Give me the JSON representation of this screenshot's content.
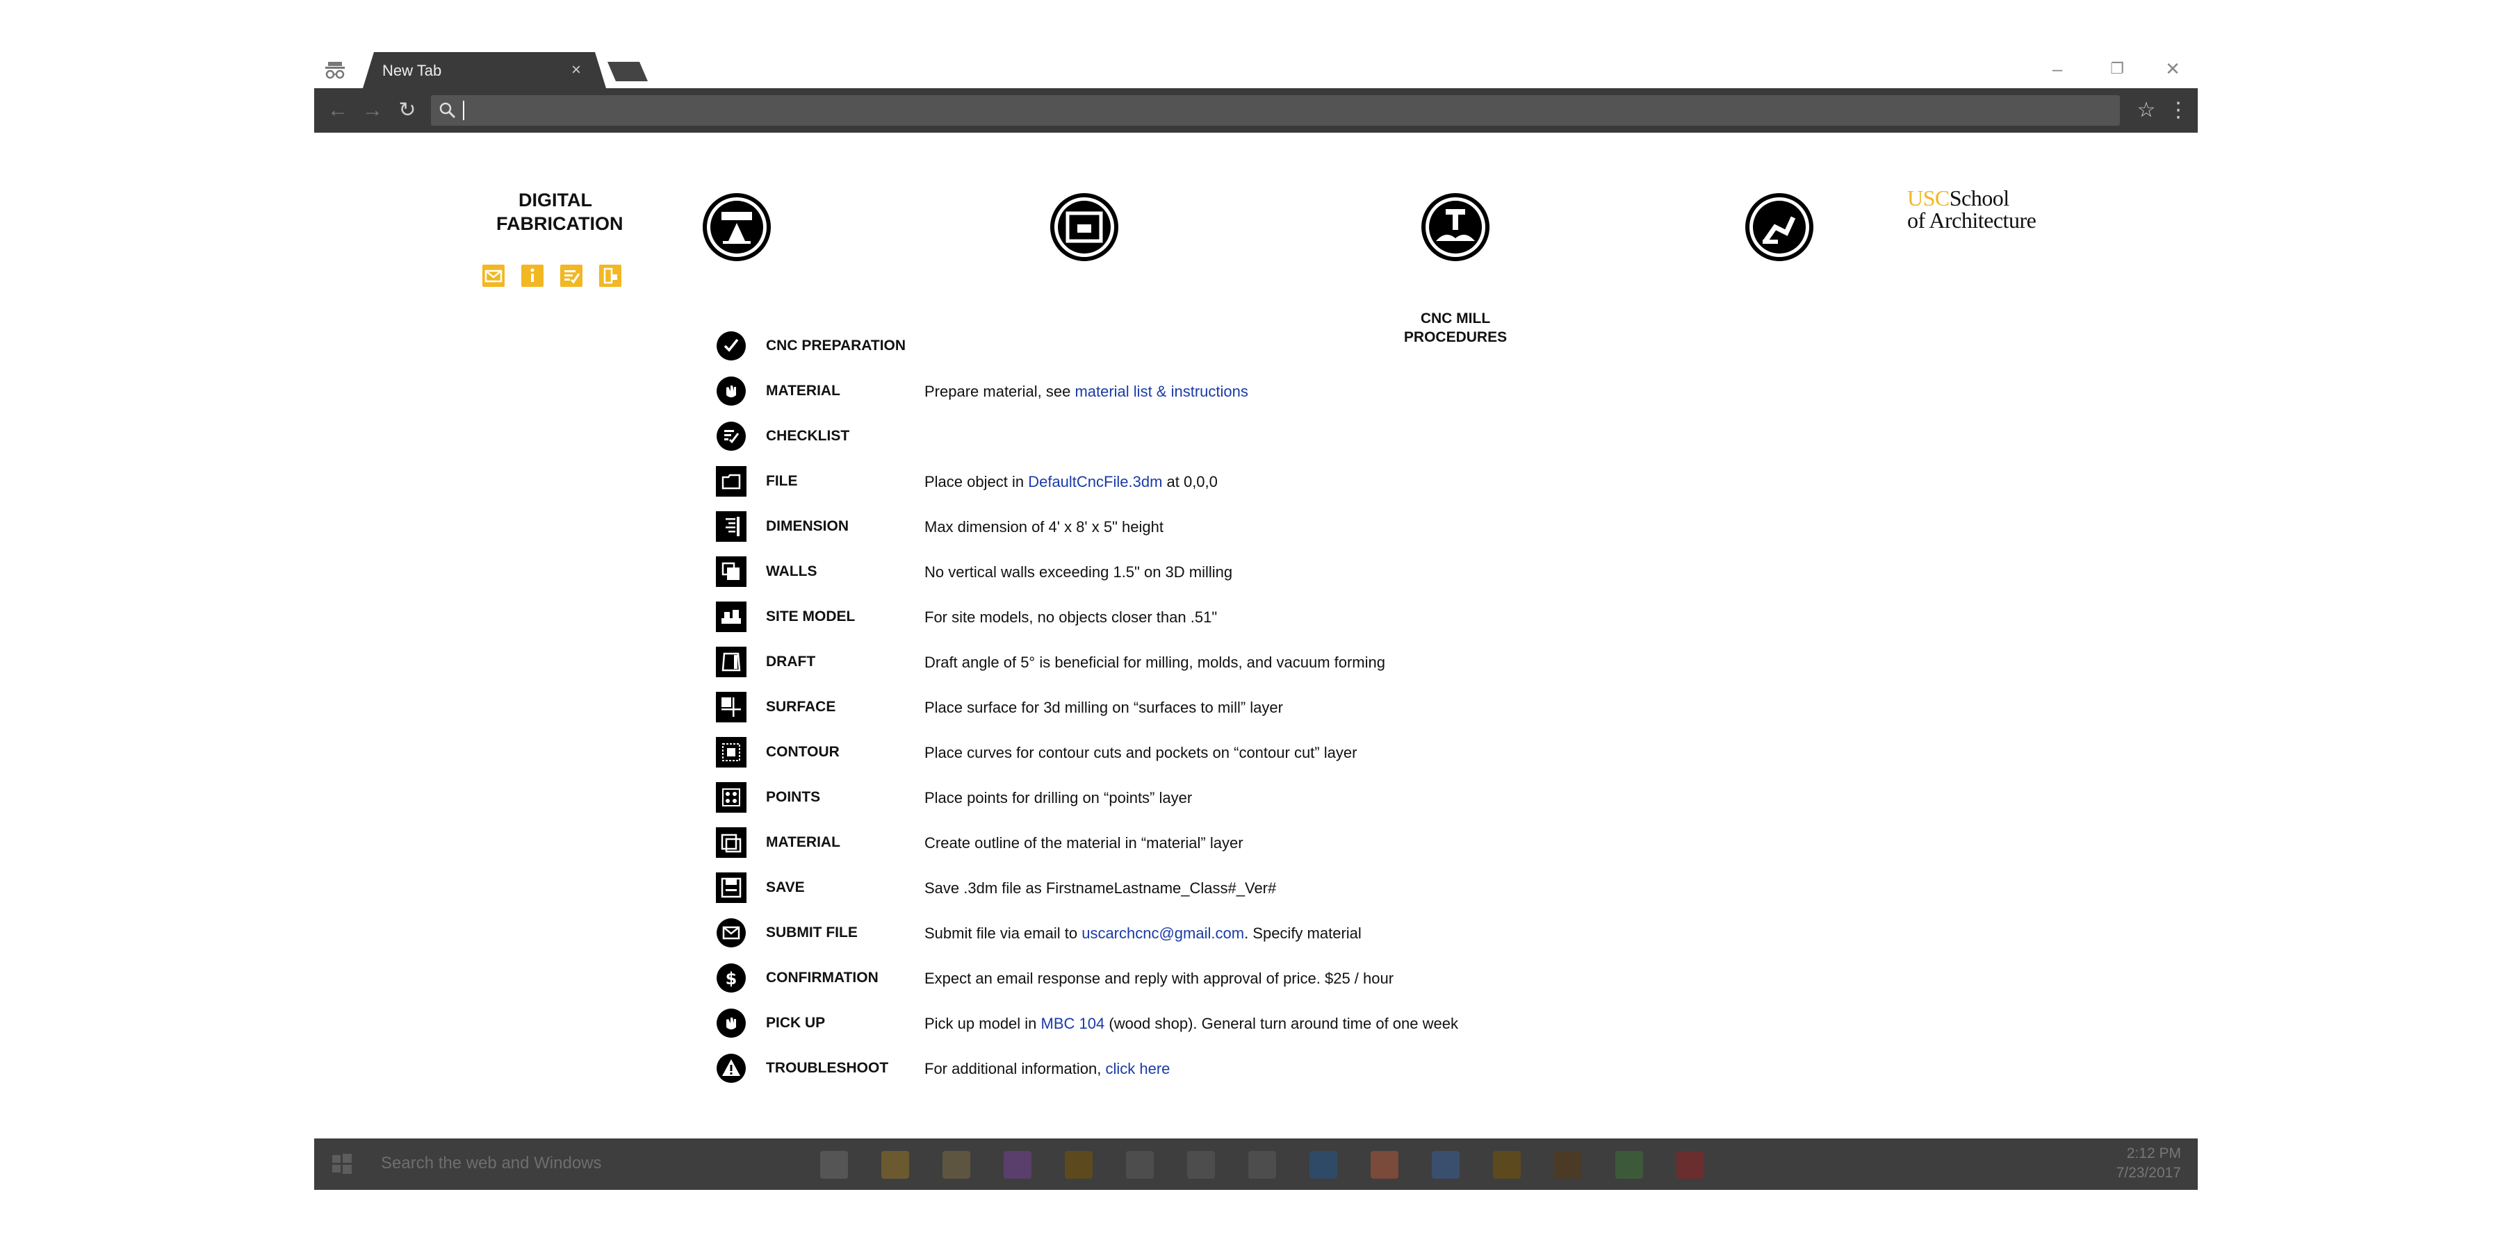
{
  "browser": {
    "tab_title": "New Tab",
    "tab_close": "×",
    "address_value": "",
    "window_controls": {
      "minimize": "–",
      "restore": "❐",
      "close": "✕"
    },
    "buttons": {
      "back": "←",
      "forward": "→",
      "reload": "↻",
      "bookmark": "☆",
      "menu": "⋮"
    }
  },
  "page": {
    "brand_line1": "DIGITAL",
    "brand_line2": "FABRICATION",
    "brand_icons": [
      "mail-icon",
      "info-icon",
      "checklist-icon",
      "pickup-icon"
    ],
    "accent_color": "#f2b722",
    "hub_label_line1": "CNC MILL",
    "hub_label_line2": "PROCEDURES",
    "usc_acronym": "USC",
    "usc_line1": "School",
    "usc_line2": "of Architecture",
    "steps": [
      {
        "icon": "checkmark-icon",
        "label": "CNC PREPARATION",
        "desc": "",
        "link": "",
        "after": ""
      },
      {
        "icon": "hand-icon",
        "label": "MATERIAL",
        "desc": "Prepare material, see ",
        "link": "material list & instructions",
        "after": ""
      },
      {
        "icon": "checklist-icon",
        "label": "CHECKLIST",
        "desc": "",
        "link": "",
        "after": ""
      },
      {
        "icon": "file-icon",
        "label": "FILE",
        "desc": "Place object in ",
        "link": "DefaultCncFile.3dm",
        "after": " at 0,0,0"
      },
      {
        "icon": "dimension-icon",
        "label": "DIMENSION",
        "desc": "Max dimension of 4' x 8' x 5\" height",
        "link": "",
        "after": ""
      },
      {
        "icon": "walls-icon",
        "label": "WALLS",
        "desc": "No vertical walls exceeding 1.5\" on 3D milling",
        "link": "",
        "after": ""
      },
      {
        "icon": "site-model-icon",
        "label": "SITE MODEL",
        "desc": "For site models, no objects closer than .51\"",
        "link": "",
        "after": ""
      },
      {
        "icon": "draft-icon",
        "label": "DRAFT",
        "desc": "Draft angle of 5° is beneficial for milling, molds, and vacuum forming",
        "link": "",
        "after": ""
      },
      {
        "icon": "surface-icon",
        "label": "SURFACE",
        "desc": "Place surface for 3d milling on “surfaces to mill” layer",
        "link": "",
        "after": ""
      },
      {
        "icon": "contour-icon",
        "label": "CONTOUR",
        "desc": "Place curves for contour cuts and pockets on “contour cut” layer",
        "link": "",
        "after": ""
      },
      {
        "icon": "points-icon",
        "label": "POINTS",
        "desc": "Place points for drilling on “points” layer",
        "link": "",
        "after": ""
      },
      {
        "icon": "material-outline-icon",
        "label": "MATERIAL",
        "desc": "Create outline of the material in “material” layer",
        "link": "",
        "after": ""
      },
      {
        "icon": "save-icon",
        "label": "SAVE",
        "desc": "Save .3dm file as FirstnameLastname_Class#_Ver#",
        "link": "",
        "after": ""
      },
      {
        "icon": "mail-icon",
        "label": "SUBMIT FILE",
        "desc": "Submit file via email to ",
        "link": "uscarchcnc@gmail.com",
        "after": ". Specify material"
      },
      {
        "icon": "dollar-icon",
        "label": "CONFIRMATION",
        "desc": "Expect an email response and reply with approval of price. $25 / hour",
        "link": "",
        "after": ""
      },
      {
        "icon": "hand-icon",
        "label": "PICK UP",
        "desc": "Pick up model in ",
        "link": "MBC 104",
        "after": " (wood shop). General turn around time of one week"
      },
      {
        "icon": "warning-icon",
        "label": "TROUBLESHOOT",
        "desc": "For additional information, ",
        "link": "click here",
        "after": ""
      }
    ]
  },
  "taskbar": {
    "search_placeholder": "Search the web and Windows",
    "time": "2:12 PM",
    "date": "7/23/2017",
    "apps": [
      "task-view",
      "file-explorer",
      "files",
      "onenote",
      "illustrator",
      "x-app",
      "globe-app",
      "phone-app",
      "photoshop",
      "chrome",
      "outlook",
      "illustrator",
      "bridge",
      "dreamweaver",
      "filezilla"
    ]
  }
}
